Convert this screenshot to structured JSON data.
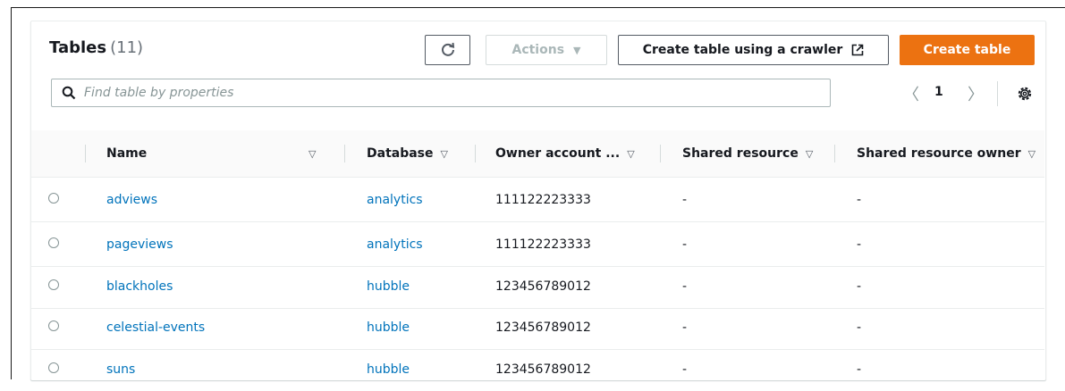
{
  "header": {
    "title": "Tables",
    "count": "(11)",
    "actions_label": "Actions",
    "crawler_label": "Create table using a crawler",
    "create_label": "Create table"
  },
  "search": {
    "placeholder": "Find table by properties"
  },
  "pagination": {
    "current_page": "1"
  },
  "columns": [
    "Name",
    "Database",
    "Owner account ...",
    "Shared resource",
    "Shared resource owner"
  ],
  "rows": [
    {
      "name": "adviews",
      "database": "analytics",
      "owner": "111122223333",
      "shared": "-",
      "shared_owner": "-"
    },
    {
      "name": "pageviews",
      "database": "analytics",
      "owner": "111122223333",
      "shared": "-",
      "shared_owner": "-"
    },
    {
      "name": "blackholes",
      "database": "hubble",
      "owner": "123456789012",
      "shared": "-",
      "shared_owner": "-"
    },
    {
      "name": "celestial-events",
      "database": "hubble",
      "owner": "123456789012",
      "shared": "-",
      "shared_owner": "-"
    },
    {
      "name": "suns",
      "database": "hubble",
      "owner": "123456789012",
      "shared": "-",
      "shared_owner": "-"
    }
  ],
  "colors": {
    "accent": "#ec7211",
    "link": "#0073bb",
    "text": "#16191f"
  },
  "icons": [
    "refresh-icon",
    "caret-down-icon",
    "external-link-icon",
    "search-icon",
    "chevron-left-icon",
    "chevron-right-icon",
    "gear-icon",
    "sort-icon"
  ]
}
